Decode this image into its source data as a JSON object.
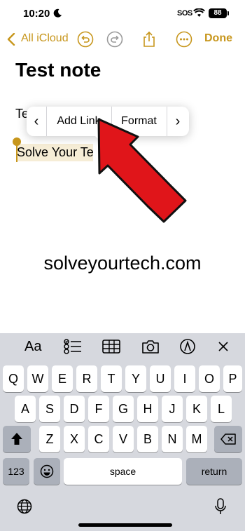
{
  "status": {
    "time": "10:20",
    "sos": "SOS",
    "battery": "88"
  },
  "nav": {
    "back_label": "All iCloud",
    "done_label": "Done"
  },
  "note": {
    "title": "Test note",
    "line1": "Te",
    "line2": "Solve Your Te"
  },
  "context_menu": {
    "prev": "‹",
    "add_link": "Add Link",
    "format": "Format",
    "next": "›"
  },
  "watermark": "solveyourtech.com",
  "toolbar": {
    "aa_label": "Aa"
  },
  "keyboard": {
    "row1": [
      "Q",
      "W",
      "E",
      "R",
      "T",
      "Y",
      "U",
      "I",
      "O",
      "P"
    ],
    "row2": [
      "A",
      "S",
      "D",
      "F",
      "G",
      "H",
      "J",
      "K",
      "L"
    ],
    "row3": [
      "Z",
      "X",
      "C",
      "V",
      "B",
      "N",
      "M"
    ],
    "numbers_label": "123",
    "space_label": "space",
    "return_label": "return"
  },
  "colors": {
    "accent": "#c7961c",
    "arrow": "#e0151a"
  }
}
